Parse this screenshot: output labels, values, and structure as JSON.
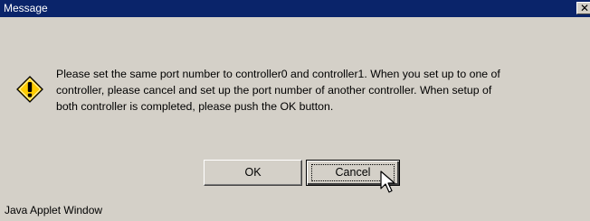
{
  "window": {
    "title": "Message",
    "close_glyph": "✕"
  },
  "message": {
    "icon": "warning-icon",
    "text": "Please set the same port number to controller0 and controller1. When you set up to one of\ncontroller, please cancel and set up the port number of another controller. When setup of\nboth controller is completed, please push the OK button."
  },
  "buttons": {
    "ok_label": "OK",
    "cancel_label": "Cancel"
  },
  "footer": {
    "status": "Java Applet Window"
  },
  "colors": {
    "dialog_bg": "#d4d0c8",
    "titlebar_bg": "#0a246a",
    "icon_fill": "#ffcc00"
  }
}
